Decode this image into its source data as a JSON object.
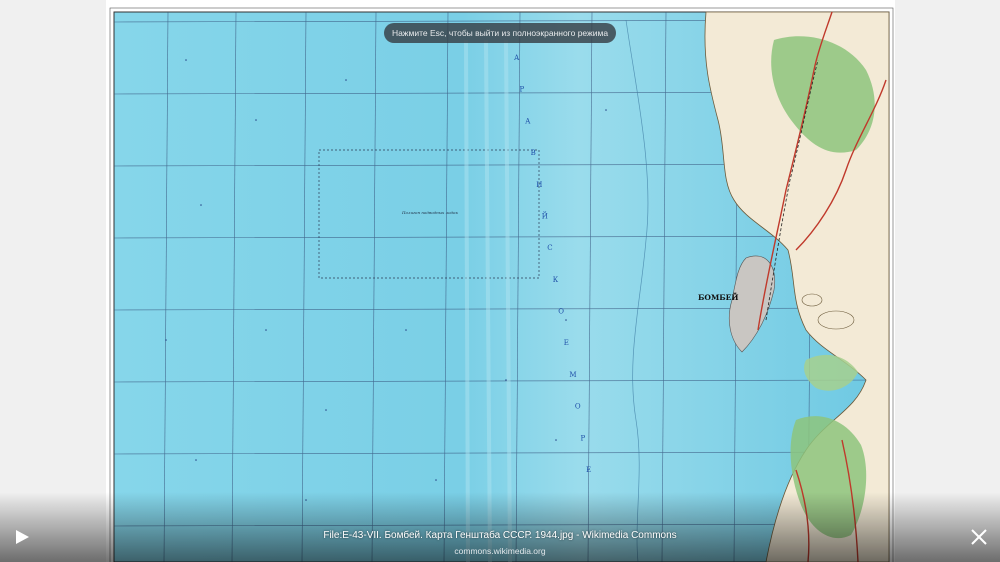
{
  "viewer": {
    "esc_hint": "Нажмите Esc, чтобы выйти из полноэкранного режима",
    "caption_title": "File:E-43-VII. Бомбей. Карта Генштаба СССР. 1944.jpg - Wikimedia Commons",
    "caption_source": "commons.wikimedia.org",
    "play_icon": "play-icon",
    "close_icon": "close-icon"
  },
  "map": {
    "city_label": "БОМБЕЙ",
    "sea_label_letters": [
      "А",
      "Р",
      "А",
      "В",
      "И",
      "Й",
      "С",
      "К",
      "О",
      "Е",
      "М",
      "О",
      "Р",
      "Е"
    ],
    "area_label": "Полигон подводных лодок",
    "colors": {
      "sea": "#7fd3e8",
      "land": "#f4ecd8",
      "forest": "#8cc47a",
      "road": "#c0392b",
      "grid": "#2a4a7a"
    }
  }
}
